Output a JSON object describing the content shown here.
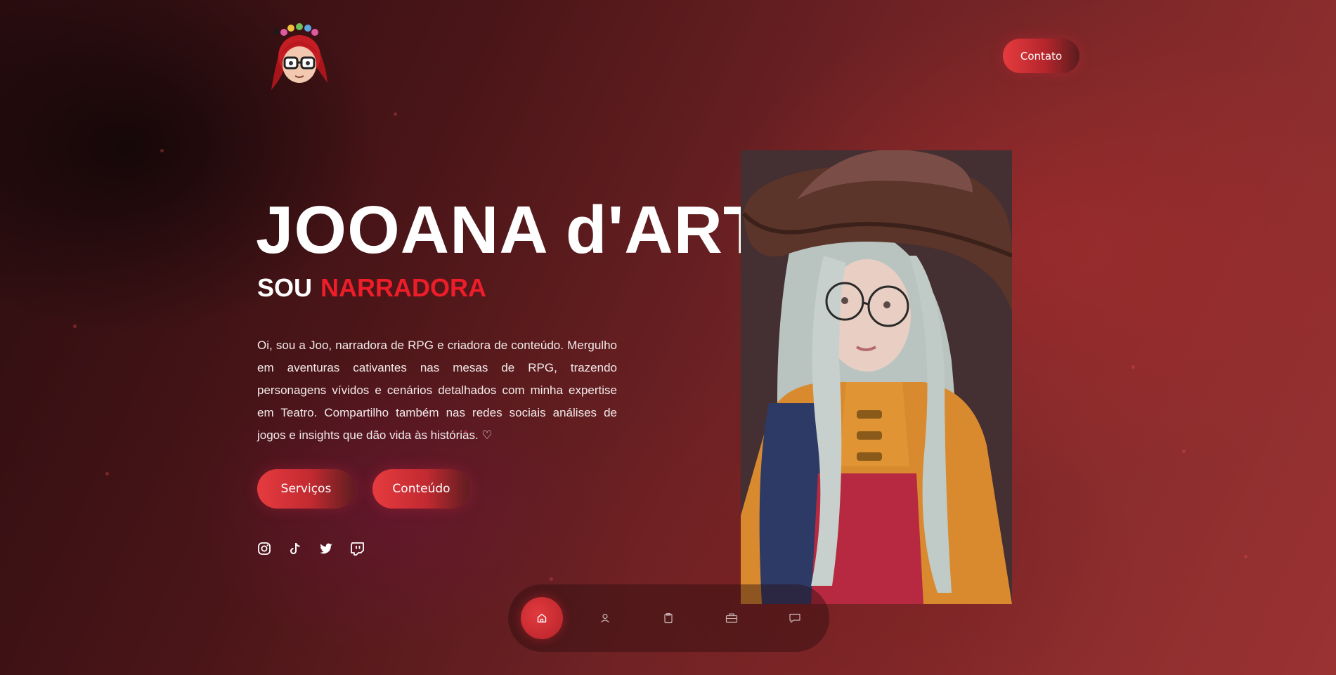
{
  "header": {
    "logo_icon": "avatar-logo-icon",
    "contact_label": "Contato"
  },
  "hero": {
    "name": "JOOANA d'ART",
    "sub_prefix": "SOU",
    "sub_role": "NARRADORA",
    "description": "Oi, sou a Joo, narradora de RPG e criadora de conteúdo. Mergulho em aventuras cativantes nas mesas de RPG, trazendo personagens vívidos e cenários detalhados com minha expertise em Teatro. Compartilho também nas redes sociais análises de jogos e insights que dão vida às histórias. ♡",
    "buttons": {
      "services": "Serviços",
      "content": "Conteúdo"
    }
  },
  "socials": [
    "instagram-icon",
    "tiktok-icon",
    "twitter-icon",
    "twitch-icon"
  ],
  "bottom_nav": {
    "items": [
      "home-icon",
      "user-icon",
      "clipboard-icon",
      "briefcase-icon",
      "chat-icon"
    ],
    "active": "home-icon"
  },
  "colors": {
    "accent": "#ee1d2a",
    "button_start": "#e63b3f",
    "button_end": "#5e1d20",
    "background_dark": "#2a0d0f",
    "background_light": "#9a3232"
  }
}
